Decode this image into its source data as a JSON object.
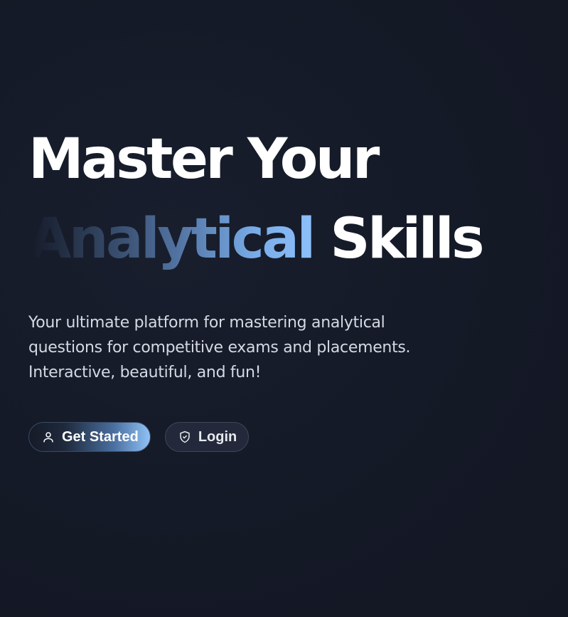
{
  "hero": {
    "title_line1": "Master Your",
    "title_accent": "Analytical",
    "title_rest": "Skills",
    "subtitle_lines": [
      "Your ultimate platform for mastering analytical",
      "questions for competitive exams and placements.",
      "Interactive, beautiful, and fun!"
    ]
  },
  "actions": {
    "primary": {
      "label": "Get Started",
      "icon": "user-icon"
    },
    "secondary": {
      "label": "Login",
      "icon": "shield-icon"
    }
  },
  "colors": {
    "background": "#151a28",
    "accent_light": "#8dc0fb",
    "text_primary": "#ffffff",
    "text_secondary": "#d4d9e3"
  }
}
